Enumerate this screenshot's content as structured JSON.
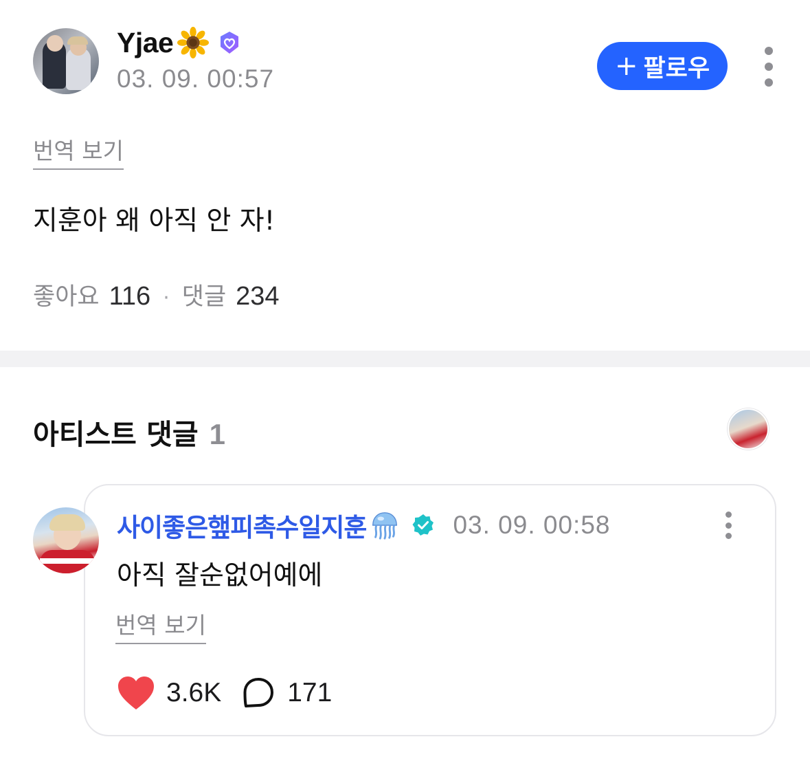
{
  "post": {
    "author_name": "Yjae",
    "author_emoji_icon": "sunflower-icon",
    "author_badge_icon": "verified-heart-badge-icon",
    "timestamp": "03. 09. 00:57",
    "follow_label": "팔로우",
    "follow_plus": "+",
    "translate_label": "번역 보기",
    "body": "지훈아 왜 아직 안 자!",
    "likes_label": "좋아요",
    "likes_count": "116",
    "separator": "·",
    "comments_label": "댓글",
    "comments_count": "234"
  },
  "artist_comments": {
    "title": "아티스트 댓글",
    "count": "1",
    "items": [
      {
        "author": "사이좋은햎피촉수일지훈",
        "author_emoji_icon": "jellyfish-icon",
        "badge_icon": "verified-check-icon",
        "timestamp": "03. 09. 00:58",
        "body": "아직 잘순없어예에",
        "translate_label": "번역 보기",
        "like_count": "3.6K",
        "reply_count": "171"
      }
    ]
  },
  "colors": {
    "accent_blue": "#2463FF",
    "artist_name_blue": "#2E5AE6",
    "heart_red": "#F0454C",
    "verified_teal": "#1FC2C8",
    "secondary_text": "#8B8B8F",
    "divider": "#F2F2F4"
  }
}
